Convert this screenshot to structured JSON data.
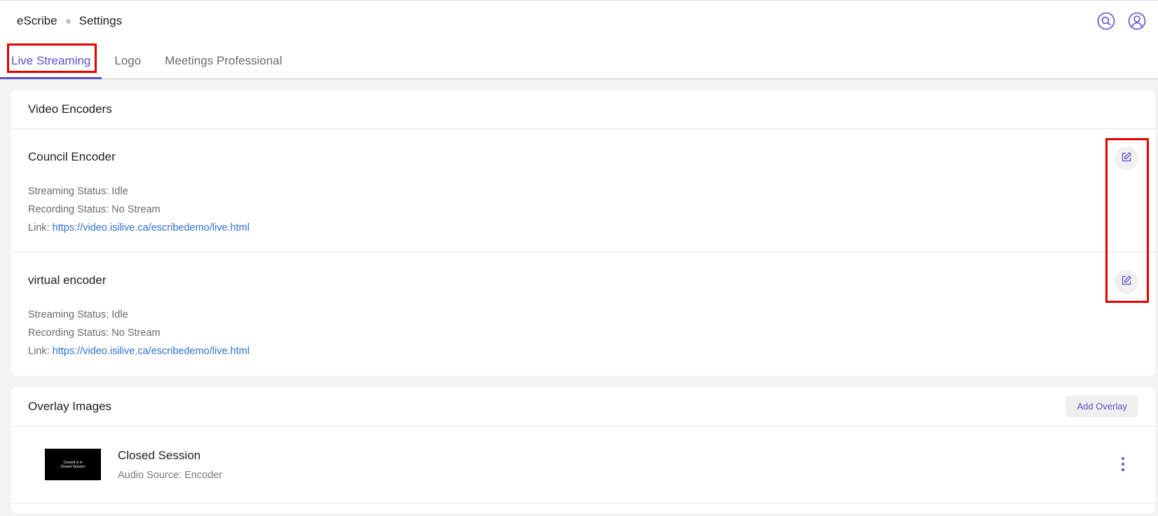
{
  "breadcrumb": {
    "root": "eScribe",
    "current": "Settings"
  },
  "icons": {
    "search": "search-icon",
    "user": "user-icon",
    "edit": "edit-icon",
    "more": "more-vertical-icon"
  },
  "tabs": [
    {
      "label": "Live Streaming",
      "active": true
    },
    {
      "label": "Logo",
      "active": false
    },
    {
      "label": "Meetings Professional",
      "active": false
    }
  ],
  "video_encoders": {
    "title": "Video Encoders",
    "items": [
      {
        "name": "Council Encoder",
        "streaming_label": "Streaming Status:",
        "streaming_value": "Idle",
        "recording_label": "Recording Status:",
        "recording_value": "No Stream",
        "link_label": "Link:",
        "link": "https://video.isilive.ca/escribedemo/live.html"
      },
      {
        "name": "virtual encoder",
        "streaming_label": "Streaming Status:",
        "streaming_value": "Idle",
        "recording_label": "Recording Status:",
        "recording_value": "No Stream",
        "link_label": "Link:",
        "link": "https://video.isilive.ca/escribedemo/live.html"
      }
    ]
  },
  "overlay_images": {
    "title": "Overlay Images",
    "add_label": "Add Overlay",
    "items": [
      {
        "title": "Closed Session",
        "subtitle": "Audio Source: Encoder",
        "thumb_line1": "Council is in",
        "thumb_line2": "Closed Session"
      }
    ]
  },
  "colors": {
    "accent": "#5a4ed1",
    "link": "#2f6fd0",
    "highlight": "#e60000"
  }
}
